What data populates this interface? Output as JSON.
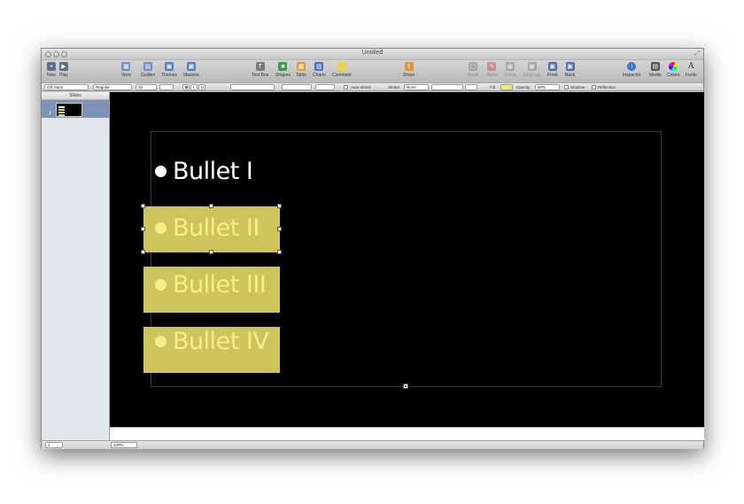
{
  "window": {
    "title": "Untitled"
  },
  "toolbar": {
    "items": [
      {
        "label": "New"
      },
      {
        "label": "Play"
      },
      {
        "label": "View"
      },
      {
        "label": "Guides"
      },
      {
        "label": "Themes"
      },
      {
        "label": "Masters"
      },
      {
        "label": "Text Box"
      },
      {
        "label": "Shapes"
      },
      {
        "label": "Table"
      },
      {
        "label": "Charts"
      },
      {
        "label": "Comment"
      },
      {
        "label": "Share"
      },
      {
        "label": "Mask"
      },
      {
        "label": "Alpha"
      },
      {
        "label": "Group"
      },
      {
        "label": "Ungroup"
      },
      {
        "label": "Front"
      },
      {
        "label": "Back"
      },
      {
        "label": "Inspector"
      },
      {
        "label": "Media"
      },
      {
        "label": "Colors"
      },
      {
        "label": "Fonts"
      }
    ]
  },
  "format_bar": {
    "font_family": "Gill Sans",
    "font_style": "Regular",
    "font_size": "26",
    "bold": "B",
    "italic": "I",
    "underline": "U",
    "autoshrink_label": "Auto-shrink",
    "stroke_label": "Stroke",
    "stroke_value": "None",
    "fill_label": "Fill",
    "fill_color": "#f2ec6a",
    "opacity_label": "Opacity",
    "opacity_value": "80%",
    "shadow_label": "Shadow",
    "reflection_label": "Reflection"
  },
  "sidebar": {
    "header": "Slides",
    "slide_number": "1"
  },
  "slide": {
    "bullets": [
      {
        "text": "Bullet I",
        "highlighted": false
      },
      {
        "text": "Bullet II",
        "highlighted": true
      },
      {
        "text": "Bullet III",
        "highlighted": true
      },
      {
        "text": "Bullet IV",
        "highlighted": true
      }
    ],
    "highlight_color": "#cdc45c",
    "bullet_color_plain": "#ffffff",
    "bullet_color_highlighted": "#f5ee8c"
  },
  "status": {
    "zoom": "100%",
    "slide_count": "1"
  }
}
